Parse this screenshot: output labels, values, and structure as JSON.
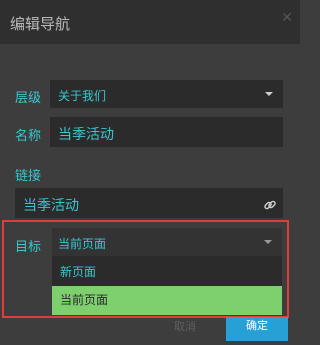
{
  "dialog": {
    "title": "编辑导航",
    "close_icon": "close-icon"
  },
  "form": {
    "level": {
      "label": "层级",
      "value": "关于我们"
    },
    "name": {
      "label": "名称",
      "value": "当季活动"
    },
    "link": {
      "label": "链接",
      "value": "当季活动",
      "icon": "link-icon"
    },
    "target": {
      "label": "目标",
      "value": "当前页面",
      "options": [
        "新页面",
        "当前页面"
      ],
      "selected_index": 1
    }
  },
  "footer": {
    "cancel_label": "取消",
    "ok_label": "确定"
  },
  "colors": {
    "accent": "#39c6cf",
    "option_selected": "#7ed06f",
    "highlight": "#e23b3b",
    "primary_button": "#27a0d5"
  }
}
